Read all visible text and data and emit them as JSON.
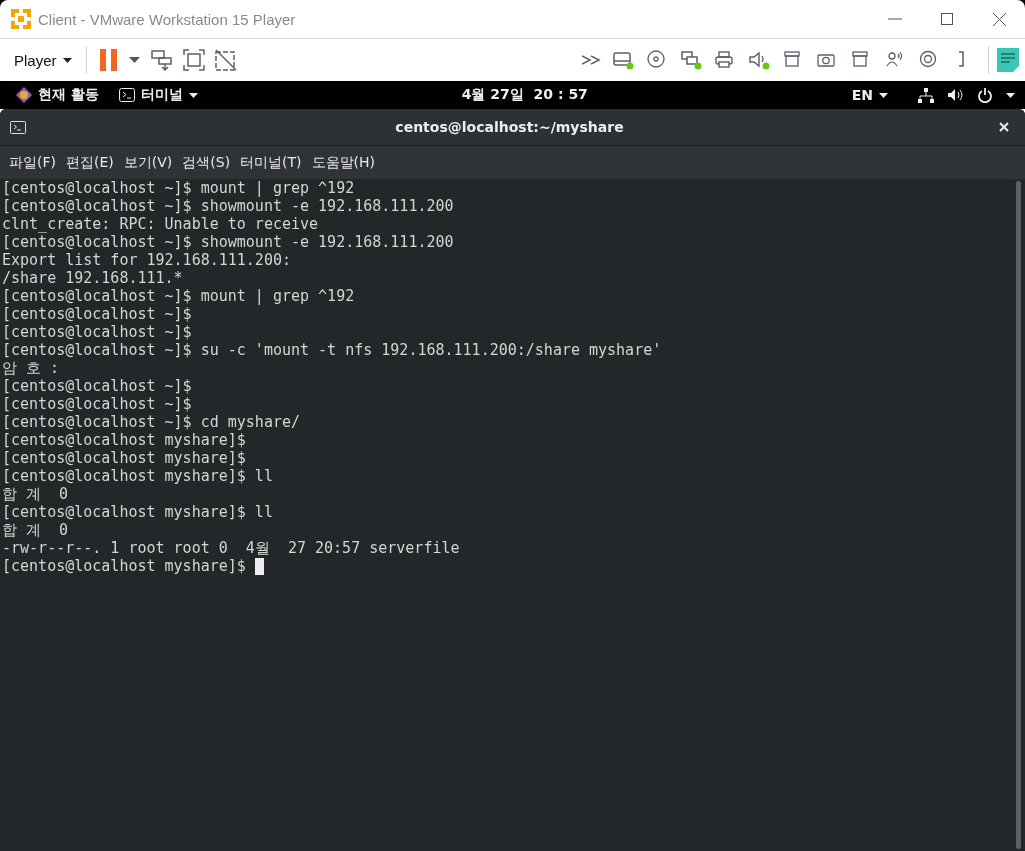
{
  "window": {
    "title": "Client - VMware Workstation 15 Player"
  },
  "toolbar": {
    "menu_label": "Player",
    "devices": [
      {
        "kind": "drive",
        "connected": true
      },
      {
        "kind": "disc",
        "connected": false
      },
      {
        "kind": "monitors",
        "connected": true
      },
      {
        "kind": "printer",
        "connected": false
      },
      {
        "kind": "speaker",
        "connected": true
      },
      {
        "kind": "tray",
        "connected": false
      },
      {
        "kind": "camera",
        "connected": false
      },
      {
        "kind": "tray",
        "connected": false
      },
      {
        "kind": "person",
        "connected": false
      },
      {
        "kind": "webcam",
        "connected": false
      },
      {
        "kind": "bracket",
        "connected": false
      }
    ]
  },
  "top_bar": {
    "activities": "현재 활동",
    "app_menu": "터미널",
    "clock": "4월 27일  20 : 57",
    "language": "EN"
  },
  "terminal": {
    "title": "centos@localhost:~/myshare",
    "menu": [
      "파일(F)",
      "편집(E)",
      "보기(V)",
      "검색(S)",
      "터미널(T)",
      "도움말(H)"
    ],
    "lines": [
      "[centos@localhost ~]$ mount | grep ^192",
      "[centos@localhost ~]$ showmount -e 192.168.111.200",
      "clnt_create: RPC: Unable to receive",
      "[centos@localhost ~]$ showmount -e 192.168.111.200",
      "Export list for 192.168.111.200:",
      "/share 192.168.111.*",
      "[centos@localhost ~]$ mount | grep ^192",
      "[centos@localhost ~]$",
      "[centos@localhost ~]$",
      "[centos@localhost ~]$ su -c 'mount -t nfs 192.168.111.200:/share myshare'",
      "암 호 :",
      "[centos@localhost ~]$",
      "[centos@localhost ~]$",
      "[centos@localhost ~]$ cd myshare/",
      "[centos@localhost myshare]$",
      "[centos@localhost myshare]$",
      "[centos@localhost myshare]$ ll",
      "합 계  0",
      "[centos@localhost myshare]$ ll",
      "합 계  0",
      "-rw-r--r--. 1 root root 0  4월  27 20:57 serverfile",
      "[centos@localhost myshare]$"
    ],
    "cursor": true
  }
}
